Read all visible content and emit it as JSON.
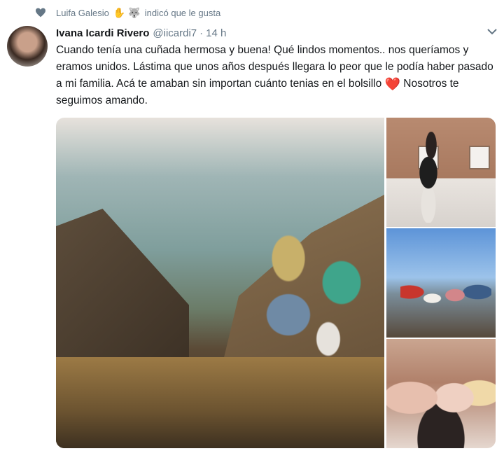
{
  "social_context": {
    "user_name": "Luifa Galesio",
    "emojis": [
      "✋",
      "🐺"
    ],
    "action_text": "indicó que le gusta"
  },
  "tweet": {
    "display_name": "Ivana Icardi Rivero",
    "handle": "@iicardi7",
    "separator": "·",
    "time": "14 h",
    "text_main": "Cuando tenía una cuñada hermosa y buena! Qué lindos momentos.. nos queríamos y eramos unidos. Lástima que unos años después llegara lo peor que le podía haber pasado a mi familia. Acá te amaban sin importan cuánto tenias en el bolsillo",
    "heart_emoji": "❤️",
    "text_end": "Nosotros te seguimos amando."
  },
  "colors": {
    "text_primary": "#14171a",
    "text_secondary": "#657786",
    "heart_red": "#d9263b"
  },
  "icons": {
    "social_context": "heart-icon",
    "menu": "chevron-down-icon"
  }
}
